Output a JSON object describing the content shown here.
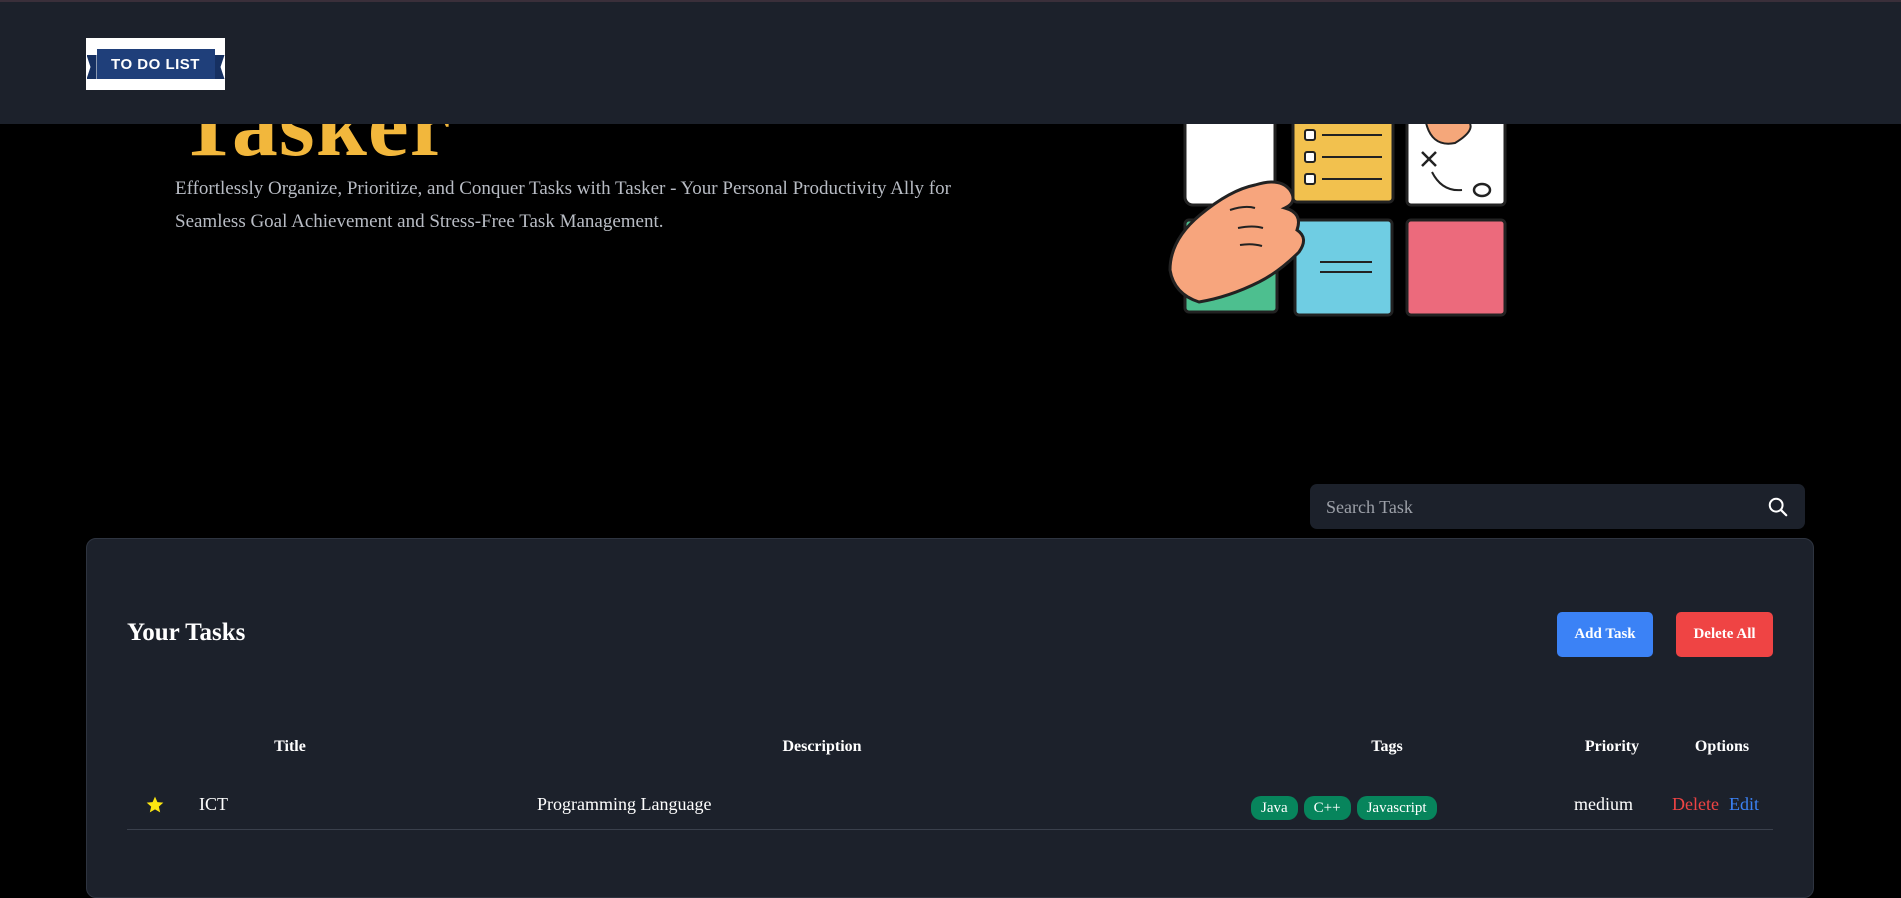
{
  "header": {
    "logo_text": "TO DO LIST"
  },
  "hero": {
    "title": "Tasker",
    "description": "Effortlessly Organize, Prioritize, and Conquer Tasks with Tasker - Your Personal Productivity Ally for Seamless Goal Achievement and Stress-Free Task Management."
  },
  "search": {
    "placeholder": "Search Task",
    "icon": "search-icon"
  },
  "tasks": {
    "heading": "Your Tasks",
    "add_label": "Add Task",
    "delete_all_label": "Delete All",
    "columns": {
      "title": "Title",
      "description": "Description",
      "tags": "Tags",
      "priority": "Priority",
      "options": "Options"
    },
    "rows": [
      {
        "favorite": true,
        "title": "ICT",
        "description": "Programming Language",
        "tags": [
          "Java",
          "C++",
          "Javascript"
        ],
        "priority": "medium",
        "delete_label": "Delete",
        "edit_label": "Edit"
      }
    ]
  },
  "colors": {
    "accent_yellow": "#f2b73c",
    "add_blue": "#3b82f6",
    "danger_red": "#ef4444",
    "tag_green": "#07855c",
    "panel_bg": "#1c212b"
  }
}
